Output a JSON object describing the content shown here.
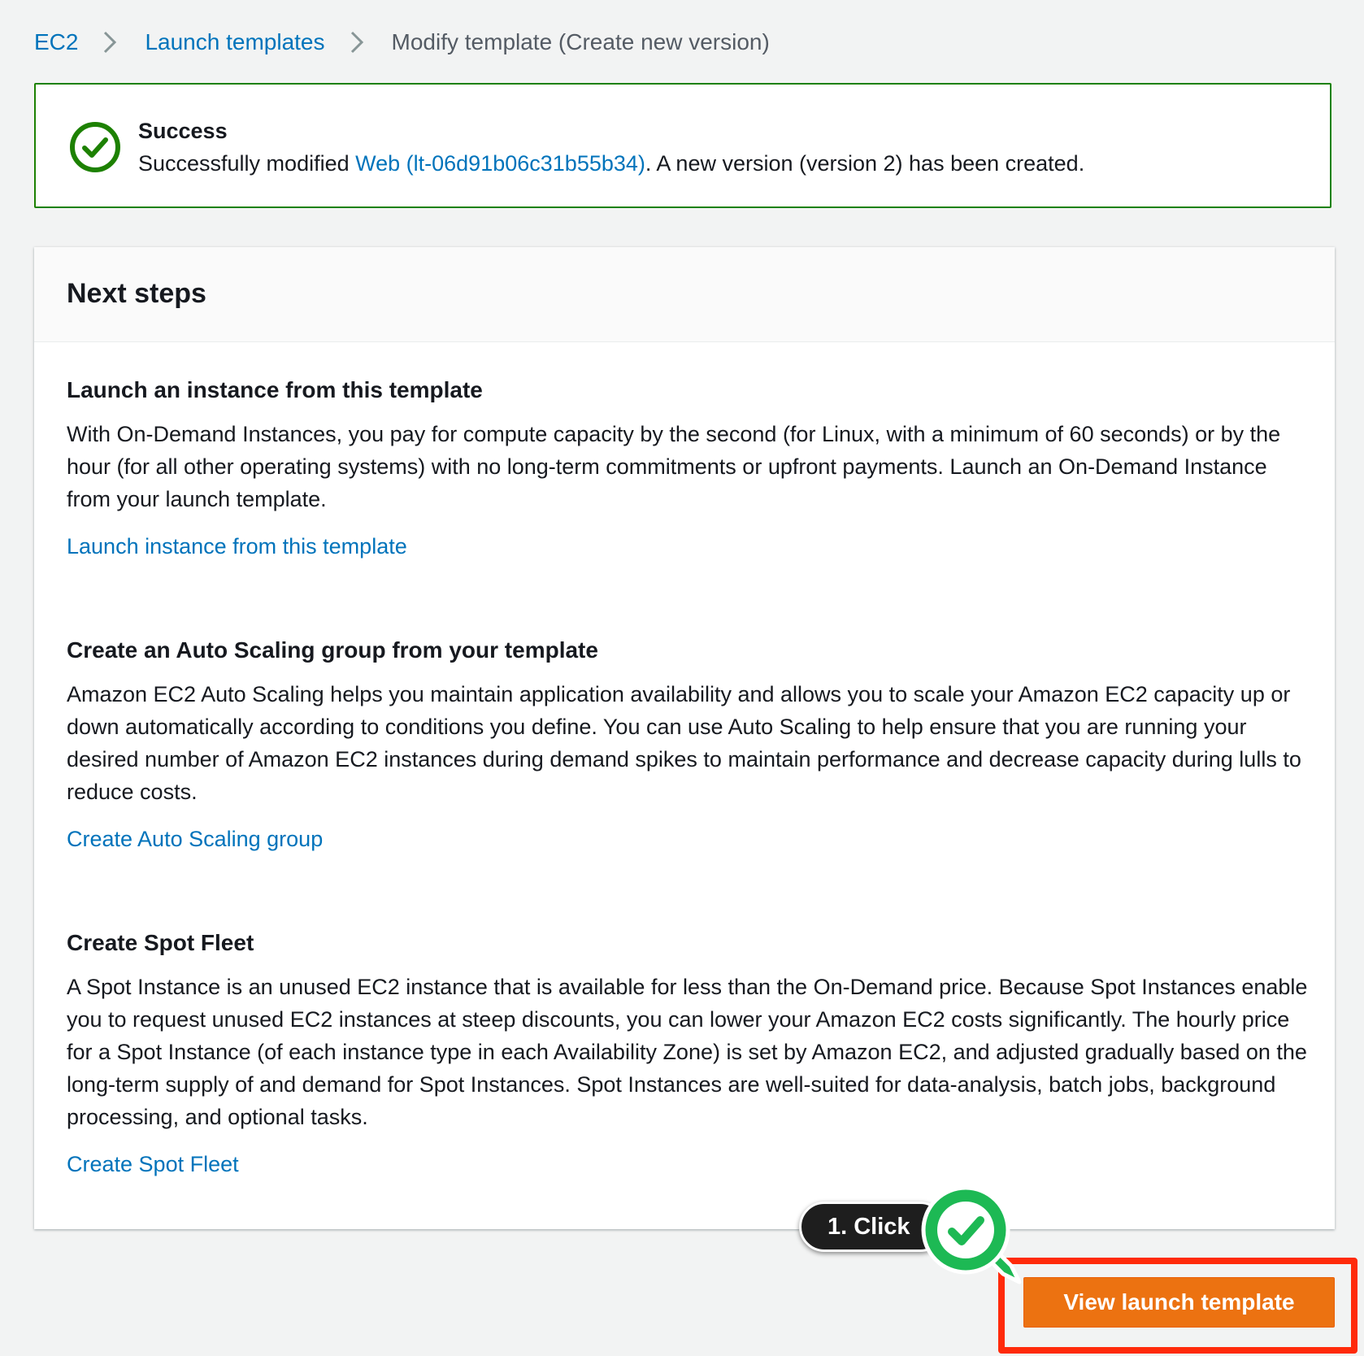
{
  "breadcrumb": {
    "items": [
      "EC2",
      "Launch templates"
    ],
    "current": "Modify template (Create new version)"
  },
  "flash": {
    "title": "Success",
    "message_prefix": "Successfully modified ",
    "link_text": "Web (lt-06d91b06c31b55b34)",
    "message_suffix": ". A new version (version 2) has been created.",
    "status_color": "#1d8102"
  },
  "next_steps": {
    "title": "Next steps",
    "sections": [
      {
        "heading": "Launch an instance from this template",
        "body": "With On-Demand Instances, you pay for compute capacity by the second (for Linux, with a minimum of 60 seconds) or by the hour (for all other operating systems) with no long-term commitments or upfront payments. Launch an On-Demand Instance from your launch template.",
        "link": "Launch instance from this template"
      },
      {
        "heading": "Create an Auto Scaling group from your template",
        "body": "Amazon EC2 Auto Scaling helps you maintain application availability and allows you to scale your Amazon EC2 capacity up or down automatically according to conditions you define. You can use Auto Scaling to help ensure that you are running your desired number of Amazon EC2 instances during demand spikes to maintain performance and decrease capacity during lulls to reduce costs.",
        "link": "Create Auto Scaling group"
      },
      {
        "heading": "Create Spot Fleet",
        "body": "A Spot Instance is an unused EC2 instance that is available for less than the On-Demand price. Because Spot Instances enable you to request unused EC2 instances at steep discounts, you can lower your Amazon EC2 costs significantly. The hourly price for a Spot Instance (of each instance type in each Availability Zone) is set by Amazon EC2, and adjusted gradually based on the long-term supply of and demand for Spot Instances. Spot Instances are well-suited for data-analysis, batch jobs, background processing, and optional tasks.",
        "link": "Create Spot Fleet"
      }
    ]
  },
  "actions": {
    "primary_label": "View launch template"
  },
  "annotation": {
    "step_label": "1. Click",
    "highlight_color": "#ff2a0a",
    "badge_color": "#1db954"
  },
  "colors": {
    "link": "#0073bb",
    "primary": "#ec7211"
  },
  "icons": {
    "flash": "success-check-circle-icon",
    "breadcrumb_separator": "chevron-right-icon",
    "annotation": "magnifier-check-icon"
  }
}
